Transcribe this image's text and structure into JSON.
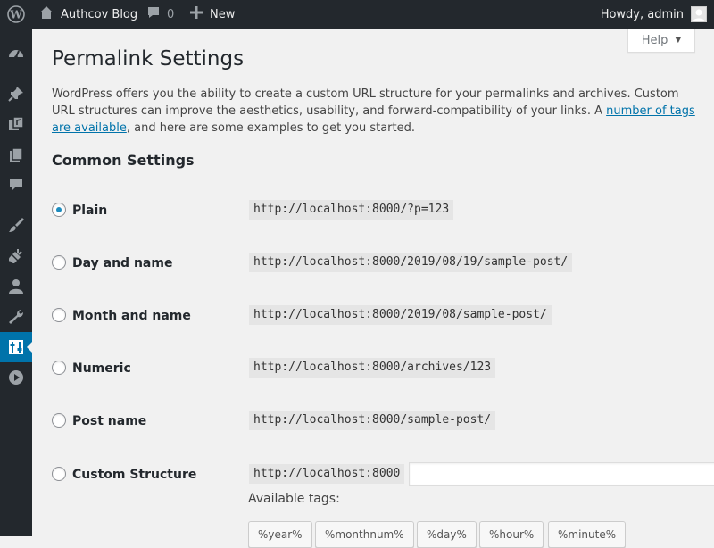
{
  "adminbar": {
    "site_name": "Authcov Blog",
    "comments_count": "0",
    "new_label": "New",
    "howdy": "Howdy, admin"
  },
  "sidebar": {
    "items": [
      {
        "name": "dashboard",
        "icon": "dashboard-icon"
      },
      {
        "name": "posts",
        "icon": "pin-icon"
      },
      {
        "name": "media",
        "icon": "media-icon"
      },
      {
        "name": "pages",
        "icon": "pages-icon"
      },
      {
        "name": "comments",
        "icon": "comment-icon"
      },
      {
        "name": "appearance",
        "icon": "brush-icon"
      },
      {
        "name": "plugins",
        "icon": "plugin-icon"
      },
      {
        "name": "users",
        "icon": "user-icon"
      },
      {
        "name": "tools",
        "icon": "wrench-icon"
      },
      {
        "name": "settings",
        "icon": "settings-icon",
        "current": true
      },
      {
        "name": "collapse",
        "icon": "play-icon"
      }
    ]
  },
  "help_tab": {
    "label": "Help"
  },
  "page": {
    "title": "Permalink Settings",
    "intro_before": "WordPress offers you the ability to create a custom URL structure for your permalinks and archives. Custom URL structures can improve the aesthetics, usability, and forward-compatibility of your links. A ",
    "intro_link": "number of tags are available",
    "intro_after": ", and here are some examples to get you started.",
    "section_title": "Common Settings"
  },
  "options": [
    {
      "label": "Plain",
      "example": "http://localhost:8000/?p=123",
      "checked": true
    },
    {
      "label": "Day and name",
      "example": "http://localhost:8000/2019/08/19/sample-post/",
      "checked": false
    },
    {
      "label": "Month and name",
      "example": "http://localhost:8000/2019/08/sample-post/",
      "checked": false
    },
    {
      "label": "Numeric",
      "example": "http://localhost:8000/archives/123",
      "checked": false
    },
    {
      "label": "Post name",
      "example": "http://localhost:8000/sample-post/",
      "checked": false
    },
    {
      "label": "Custom Structure",
      "example": "http://localhost:8000",
      "checked": false
    }
  ],
  "custom_structure_value": "",
  "available_tags_label": "Available tags:",
  "tags": [
    "%year%",
    "%monthnum%",
    "%day%",
    "%hour%",
    "%minute%"
  ],
  "colors": {
    "admin_bar": "#23282d",
    "accent": "#0073aa",
    "background": "#f1f1f1"
  }
}
